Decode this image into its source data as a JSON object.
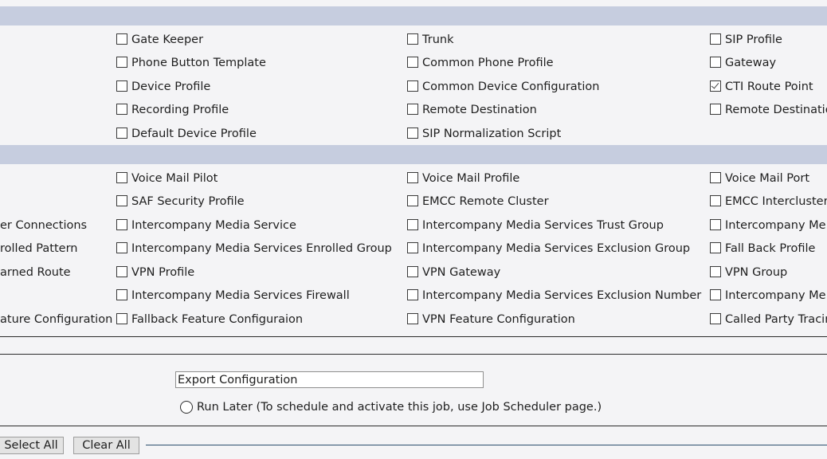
{
  "section1": {
    "col1": [
      {
        "label": "Gate Keeper",
        "checked": false
      },
      {
        "label": "Phone Button Template",
        "checked": false
      },
      {
        "label": "Device Profile",
        "checked": false
      },
      {
        "label": "Recording Profile",
        "checked": false
      },
      {
        "label": "Default Device Profile",
        "checked": false
      }
    ],
    "col2": [
      {
        "label": "Trunk",
        "checked": false
      },
      {
        "label": "Common Phone Profile",
        "checked": false
      },
      {
        "label": "Common Device Configuration",
        "checked": false
      },
      {
        "label": "Remote Destination",
        "checked": false
      },
      {
        "label": "SIP Normalization Script",
        "checked": false
      }
    ],
    "col3": [
      {
        "label": "SIP Profile",
        "checked": false
      },
      {
        "label": "Gateway",
        "checked": false
      },
      {
        "label": "CTI Route Point",
        "checked": true
      },
      {
        "label": "Remote Destinatio",
        "checked": false
      }
    ]
  },
  "section2": {
    "col0": [
      "er Connections",
      "rolled Pattern",
      "arned Route",
      "ature Configuration"
    ],
    "col1": [
      {
        "label": "Voice Mail Pilot",
        "checked": false
      },
      {
        "label": "SAF Security Profile",
        "checked": false
      },
      {
        "label": "Intercompany Media Service",
        "checked": false
      },
      {
        "label": "Intercompany Media Services Enrolled Group",
        "checked": false
      },
      {
        "label": "VPN Profile",
        "checked": false
      },
      {
        "label": "Intercompany Media Services Firewall",
        "checked": false
      },
      {
        "label": "Fallback Feature Configuraion",
        "checked": false
      }
    ],
    "col2": [
      {
        "label": "Voice Mail Profile",
        "checked": false
      },
      {
        "label": "EMCC Remote Cluster",
        "checked": false
      },
      {
        "label": "Intercompany Media Services Trust Group",
        "checked": false
      },
      {
        "label": "Intercompany Media Services Exclusion Group",
        "checked": false
      },
      {
        "label": "VPN Gateway",
        "checked": false
      },
      {
        "label": "Intercompany Media Services Exclusion Number",
        "checked": false
      },
      {
        "label": "VPN Feature Configuration",
        "checked": false
      }
    ],
    "col3": [
      {
        "label": "Voice Mail Port",
        "checked": false
      },
      {
        "label": "EMCC Intercluster",
        "checked": false
      },
      {
        "label": "Intercompany Me",
        "checked": false
      },
      {
        "label": "Fall Back Profile",
        "checked": false
      },
      {
        "label": "VPN Group",
        "checked": false
      },
      {
        "label": "Intercompany Me",
        "checked": false
      },
      {
        "label": "Called Party Tracin",
        "checked": false
      }
    ]
  },
  "job": {
    "description_value": "Export Configuration",
    "run_later_label": "Run Later (To schedule and activate this job, use Job Scheduler page.)"
  },
  "buttons": {
    "select_all": "Select All",
    "clear_all": "Clear All"
  }
}
